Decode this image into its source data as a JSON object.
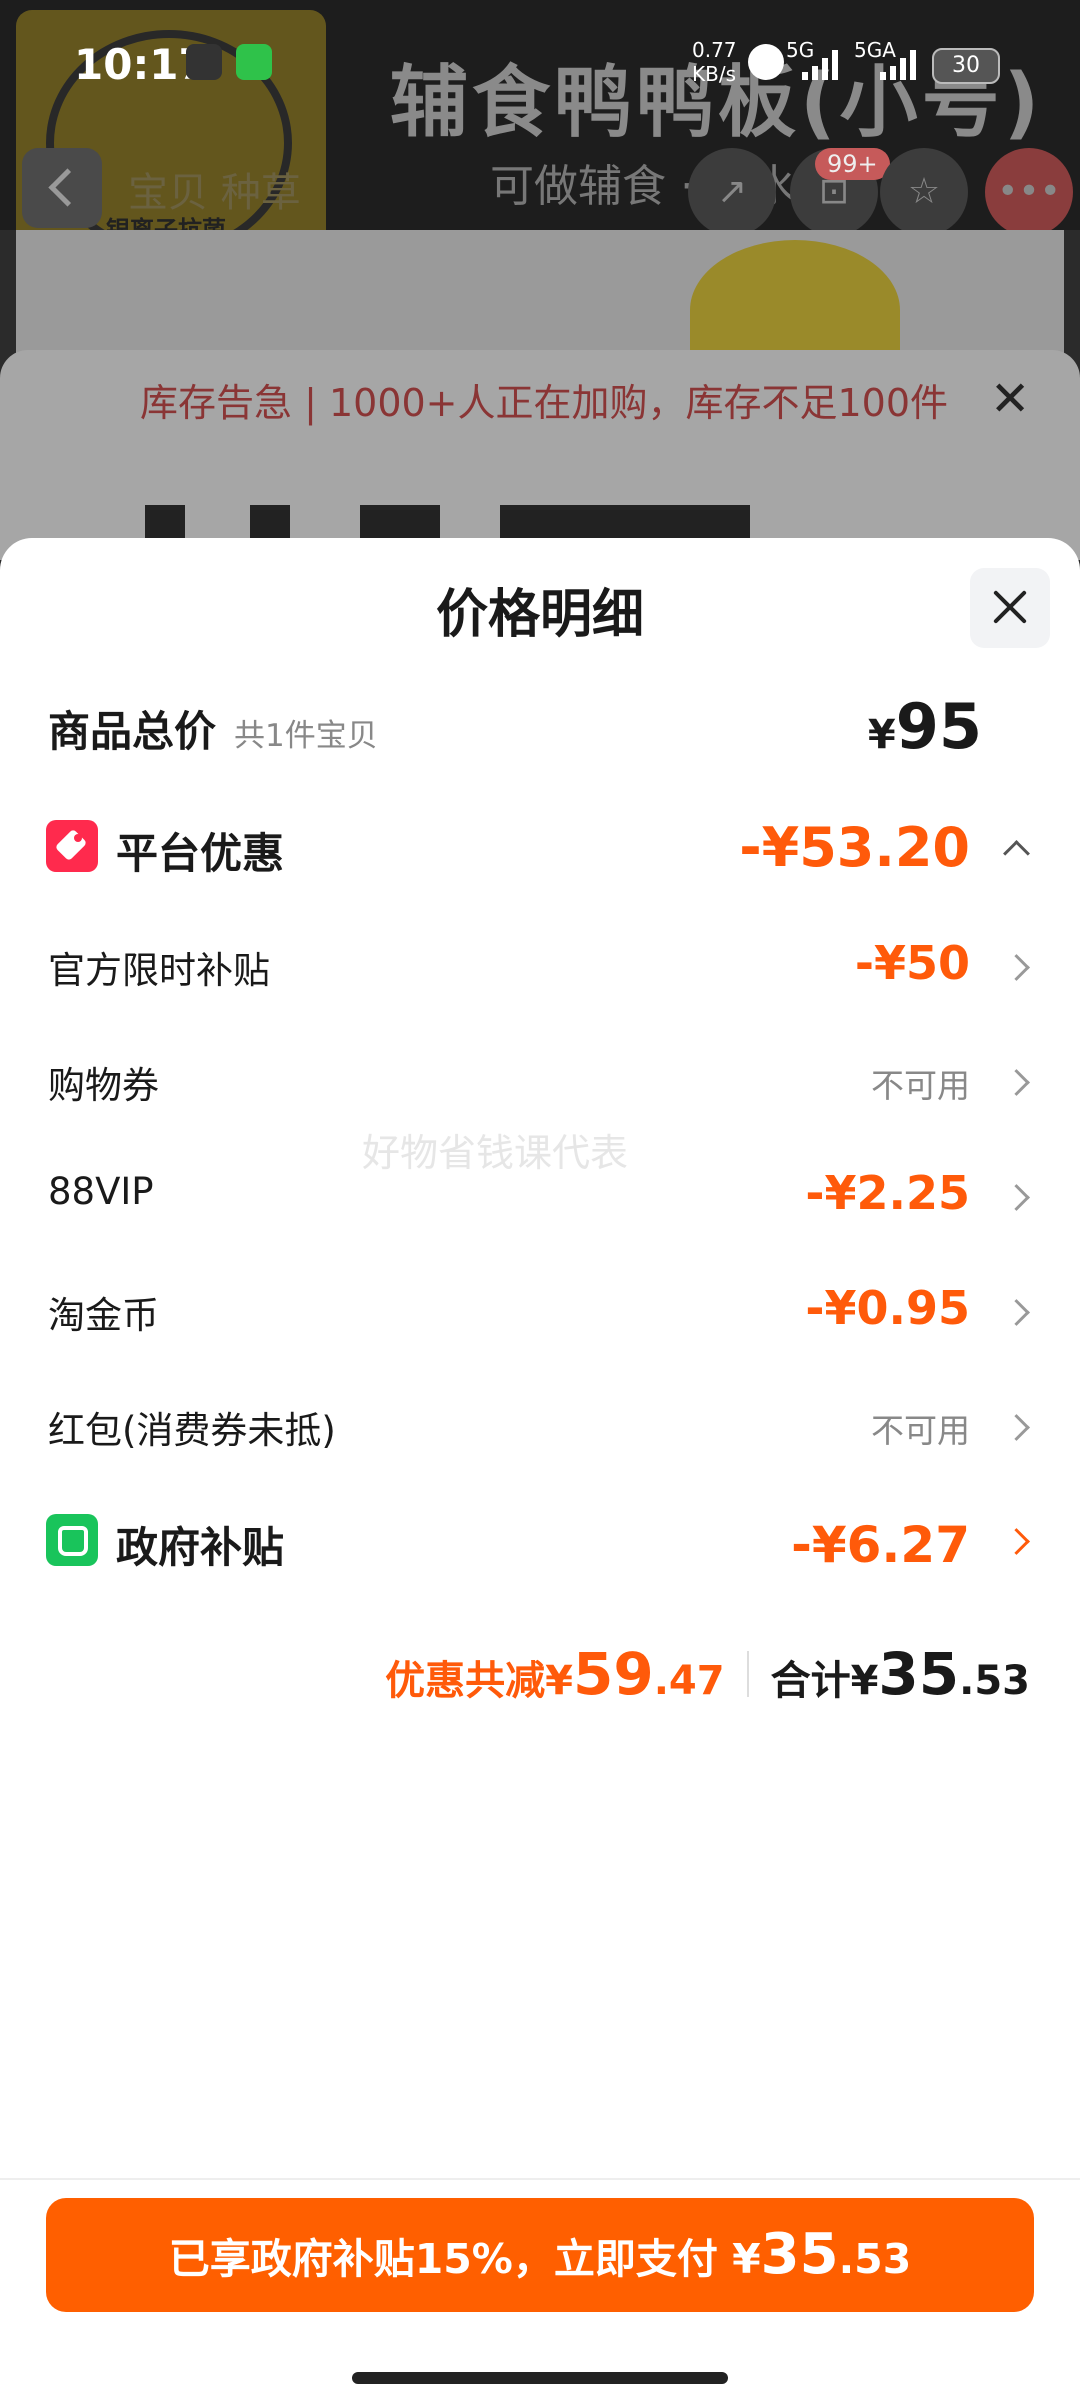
{
  "status_bar": {
    "time": "10:17",
    "net_speed_top": "0.77",
    "net_speed_unit": "KB/s",
    "sim1": "5G",
    "sim2": "5GA",
    "battery": "30"
  },
  "background": {
    "product_title": "辅食鸭鸭板(小号)",
    "product_subtitle": "可做辅食 · 切水果",
    "badge_text": "银离子抗菌",
    "tabs": "宝贝  种草",
    "cart_count": "99+",
    "stock_notice": "库存告急 | 1000+人正在加购，库存不足100件"
  },
  "sheet": {
    "title": "价格明细",
    "total": {
      "label": "商品总价",
      "sub": "共1件宝贝",
      "currency": "¥",
      "value": "95"
    },
    "platform": {
      "label": "平台优惠",
      "value": "-¥53.20"
    },
    "items": [
      {
        "label": "官方限时补贴",
        "value": "-¥50",
        "status": "applied"
      },
      {
        "label": "购物券",
        "value": "不可用",
        "status": "unavailable"
      },
      {
        "label": "88VIP",
        "value": "-¥2.25",
        "status": "applied"
      },
      {
        "label": "淘金币",
        "value": "-¥0.95",
        "status": "applied"
      },
      {
        "label": "红包(消费券未抵)",
        "value": "不可用",
        "status": "unavailable"
      }
    ],
    "government": {
      "label": "政府补贴",
      "value": "-¥6.27"
    },
    "watermark": "好物省钱课代表",
    "summary": {
      "discount_label": "优惠共减¥",
      "discount_int": "59",
      "discount_dec": ".47",
      "total_label": "合计¥",
      "total_int": "35",
      "total_dec": ".53"
    }
  },
  "pay_button": {
    "prefix": "已享政府补贴15%，立即支付 ¥",
    "amount_int": "35",
    "amount_dec": ".53"
  },
  "colors": {
    "accent": "#ff5a0a",
    "button": "#ff5f00",
    "platform_icon": "#ff2a4d",
    "government_icon": "#19c45b"
  }
}
